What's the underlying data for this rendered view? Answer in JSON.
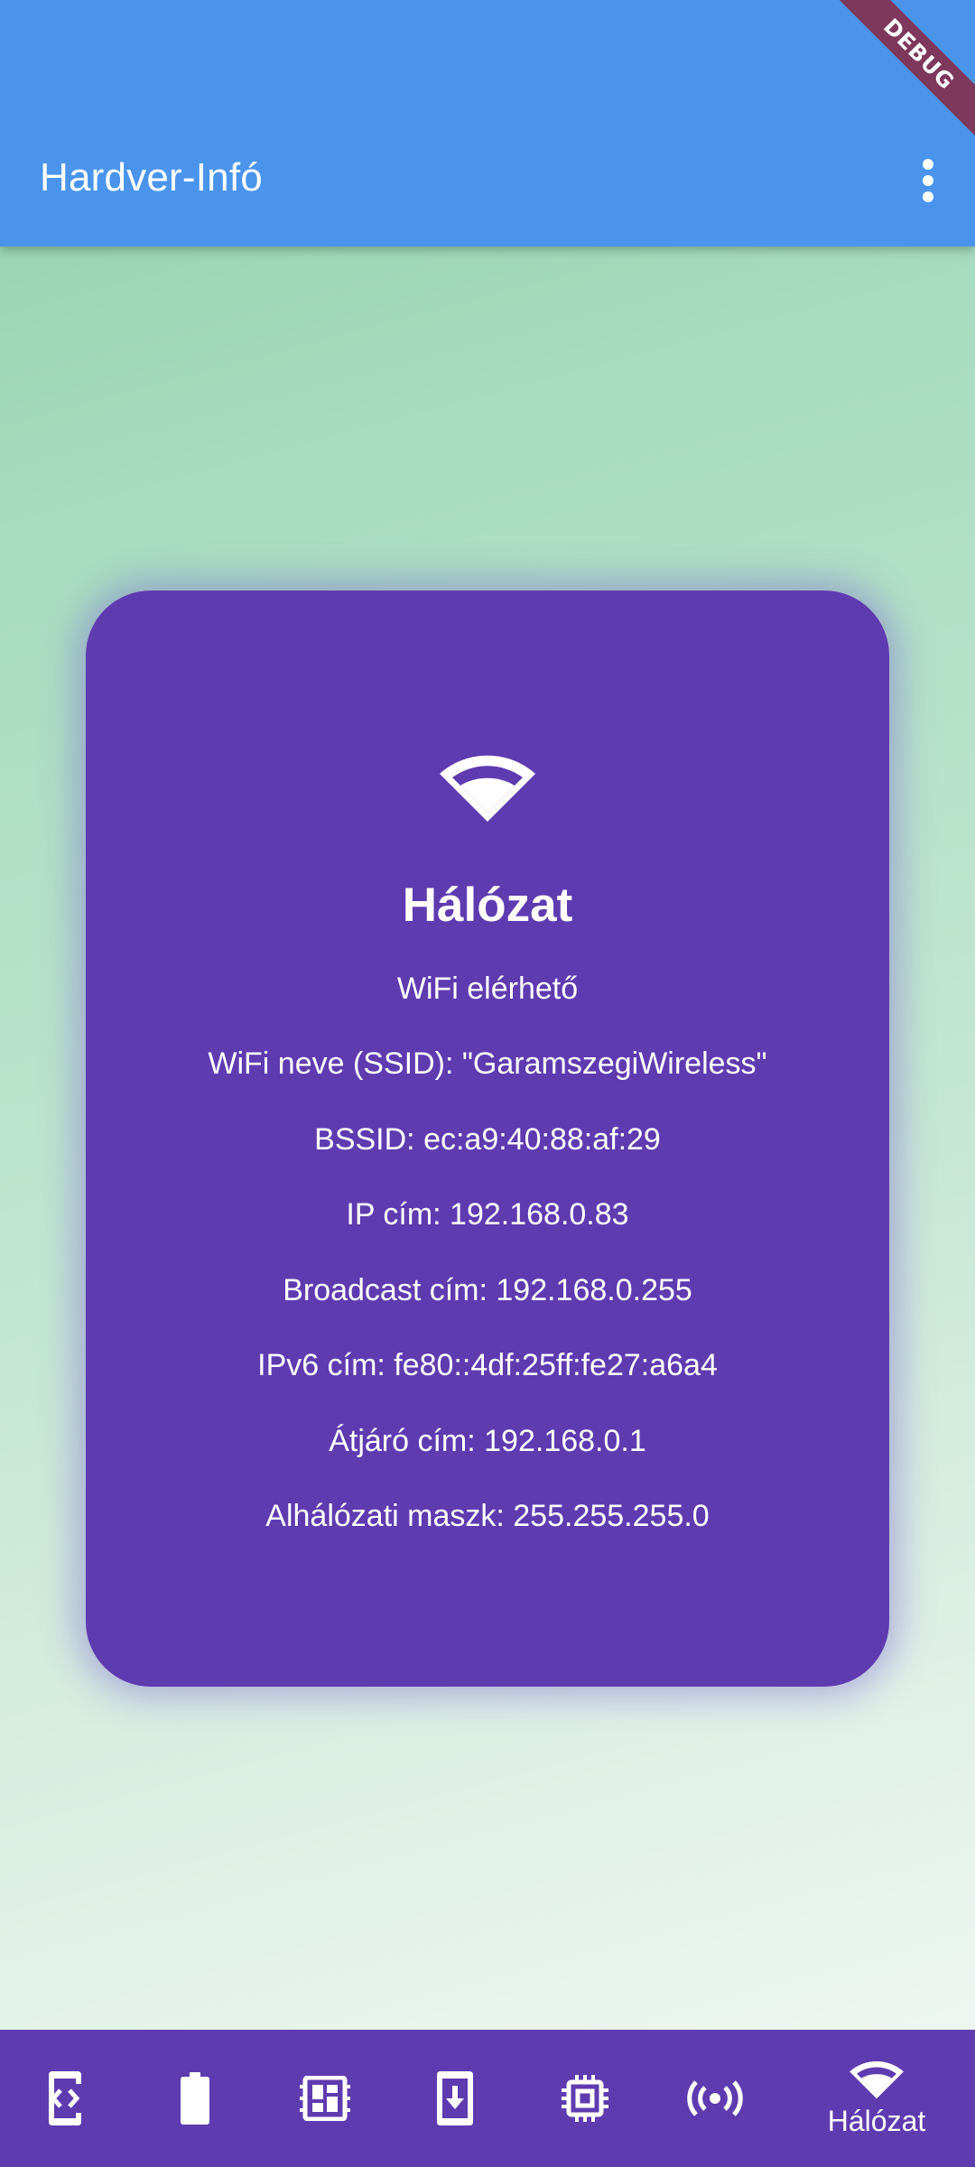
{
  "app_bar": {
    "title": "Hardver-Infó",
    "debug_banner": "DEBUG",
    "menu_icon": "more-vert-icon"
  },
  "card": {
    "icon": "wifi-icon",
    "title": "Hálózat",
    "lines": [
      "WiFi elérhető",
      "WiFi neve (SSID): \"GaramszegiWireless\"",
      "BSSID: ec:a9:40:88:af:29",
      "IP cím: 192.168.0.83",
      "Broadcast cím: 192.168.0.255",
      "IPv6 cím: fe80::4df:25ff:fe27:a6a4",
      "Átjáró cím: 192.168.0.1",
      "Alhálózati maszk: 255.255.255.0"
    ]
  },
  "bottom_nav": {
    "items": [
      {
        "icon": "developer-mode-icon",
        "label": ""
      },
      {
        "icon": "battery-icon",
        "label": ""
      },
      {
        "icon": "dashboard-chip-icon",
        "label": ""
      },
      {
        "icon": "system-update-icon",
        "label": ""
      },
      {
        "icon": "memory-chip-icon",
        "label": ""
      },
      {
        "icon": "sensors-icon",
        "label": ""
      },
      {
        "icon": "wifi-icon",
        "label": "Hálózat",
        "selected": true
      }
    ]
  },
  "colors": {
    "app_bar": "#4a95eb",
    "card": "#5f3bb0",
    "bottom_nav": "#5f3bb0",
    "text": "#ffffff"
  }
}
